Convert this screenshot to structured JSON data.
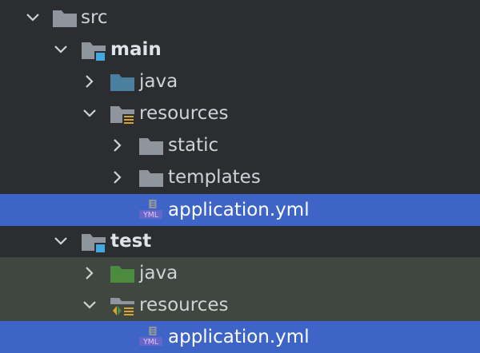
{
  "colors": {
    "background": "#2b2d30",
    "selection": "#3d64c6",
    "test_scope_bg": "#3f4740",
    "folder_gray": "#8f959c",
    "folder_blue": "#4a7fa0",
    "folder_green": "#4c8a3f",
    "module_marker": "#3fa9e0",
    "resources_marker": "#d6a431",
    "yml_purple": "#b06ad2"
  },
  "tree": {
    "src": {
      "label": "src",
      "icon": "folder-icon",
      "expanded": true
    },
    "main": {
      "label": "main",
      "icon": "source-root-folder-icon",
      "expanded": true
    },
    "main_java": {
      "label": "java",
      "icon": "source-folder-icon",
      "expanded": false
    },
    "main_resources": {
      "label": "resources",
      "icon": "resources-folder-icon",
      "expanded": true
    },
    "static": {
      "label": "static",
      "icon": "folder-icon",
      "expanded": false
    },
    "templates": {
      "label": "templates",
      "icon": "folder-icon",
      "expanded": false
    },
    "main_application": {
      "label": "application.yml",
      "icon": "yml-file-icon",
      "selected": true,
      "badge": "YML"
    },
    "test": {
      "label": "test",
      "icon": "source-root-folder-icon",
      "expanded": true
    },
    "test_java": {
      "label": "java",
      "icon": "test-source-folder-icon",
      "expanded": false
    },
    "test_resources": {
      "label": "resources",
      "icon": "test-resources-folder-icon",
      "expanded": true
    },
    "test_application": {
      "label": "application.yml",
      "icon": "yml-file-icon",
      "selected": true,
      "badge": "YML"
    }
  }
}
